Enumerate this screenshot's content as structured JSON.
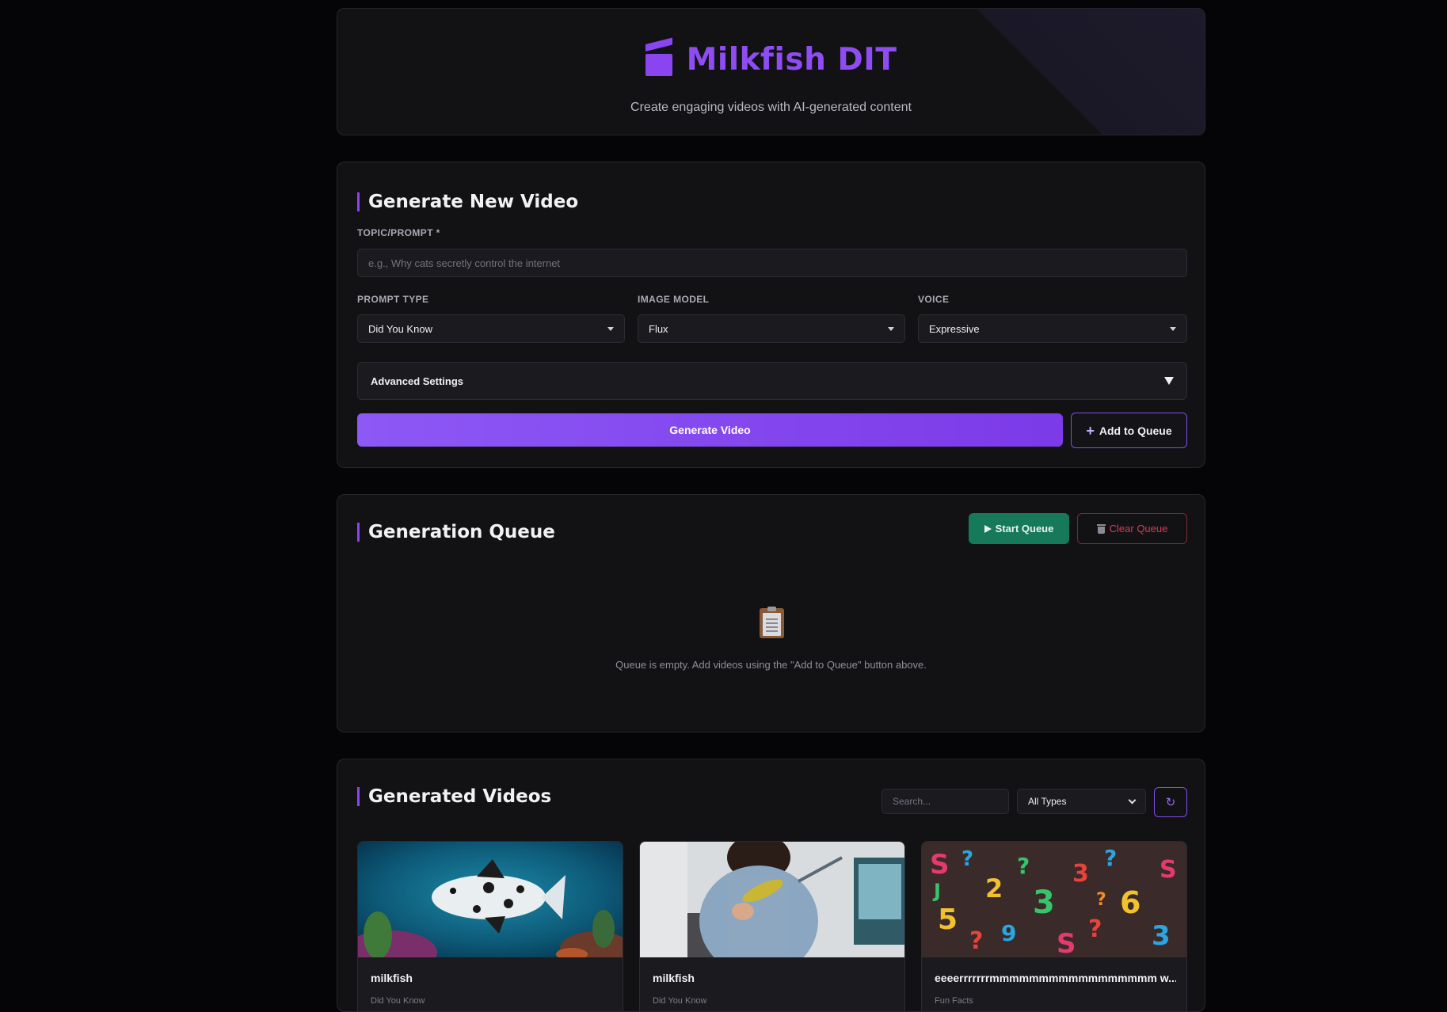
{
  "header": {
    "title": "Milkfish DIT",
    "subtitle": "Create engaging videos with AI-generated content",
    "icon": "clapperboard-icon",
    "accent": "#8b45f0"
  },
  "generate": {
    "title": "Generate New Video",
    "topic_label": "TOPIC/PROMPT *",
    "topic_placeholder": "e.g., Why cats secretly control the internet",
    "prompt_type_label": "PROMPT TYPE",
    "prompt_type_value": "Did You Know",
    "image_model_label": "IMAGE MODEL",
    "image_model_value": "Flux",
    "voice_label": "VOICE",
    "voice_value": "Expressive",
    "advanced_label": "Advanced Settings",
    "generate_button": "Generate Video",
    "queue_button": "Add to Queue"
  },
  "queue": {
    "title": "Generation Queue",
    "start_button": "Start Queue",
    "clear_button": "Clear Queue",
    "empty_text": "Queue is empty. Add videos using the \"Add to Queue\" button above."
  },
  "videos": {
    "title": "Generated Videos",
    "search_placeholder": "Search...",
    "type_filter": "All Types",
    "refresh_icon": "↻",
    "items": [
      {
        "title": "milkfish",
        "type": "Did You Know"
      },
      {
        "title": "milkfish",
        "type": "Did You Know"
      },
      {
        "title": "eeeerrrrrrrmmmmmmmmmmmmmmmmm w...",
        "type": "Fun Facts"
      }
    ]
  }
}
